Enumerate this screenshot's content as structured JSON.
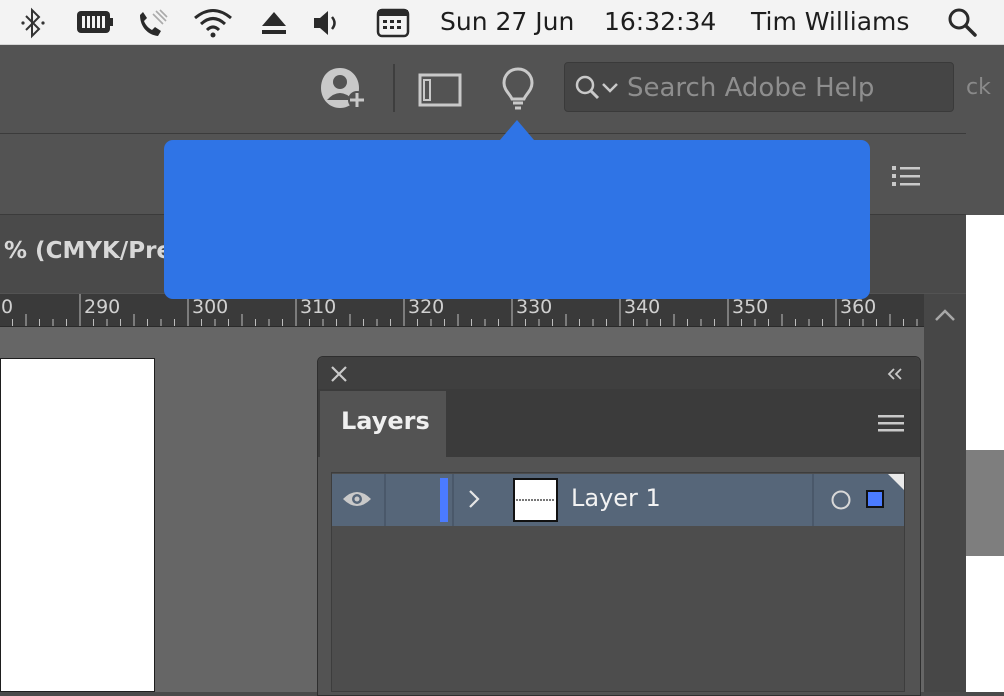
{
  "menubar": {
    "date": "Sun 27 Jun",
    "time": "16:32:34",
    "user": "Tim Williams"
  },
  "header": {
    "search_placeholder": "Search Adobe Help",
    "hidden_label": "ck"
  },
  "document": {
    "tab_label": "% (CMYK/Pre"
  },
  "ruler": {
    "labels": [
      "0",
      "290",
      "300",
      "310",
      "320",
      "330",
      "340",
      "350",
      "360"
    ]
  },
  "layers_panel": {
    "tab_label": "Layers",
    "layers": [
      {
        "name": "Layer 1"
      }
    ]
  },
  "colors": {
    "tooltip": "#2f74e6",
    "layer_color": "#4b7bff",
    "selected_row": "#566679"
  }
}
